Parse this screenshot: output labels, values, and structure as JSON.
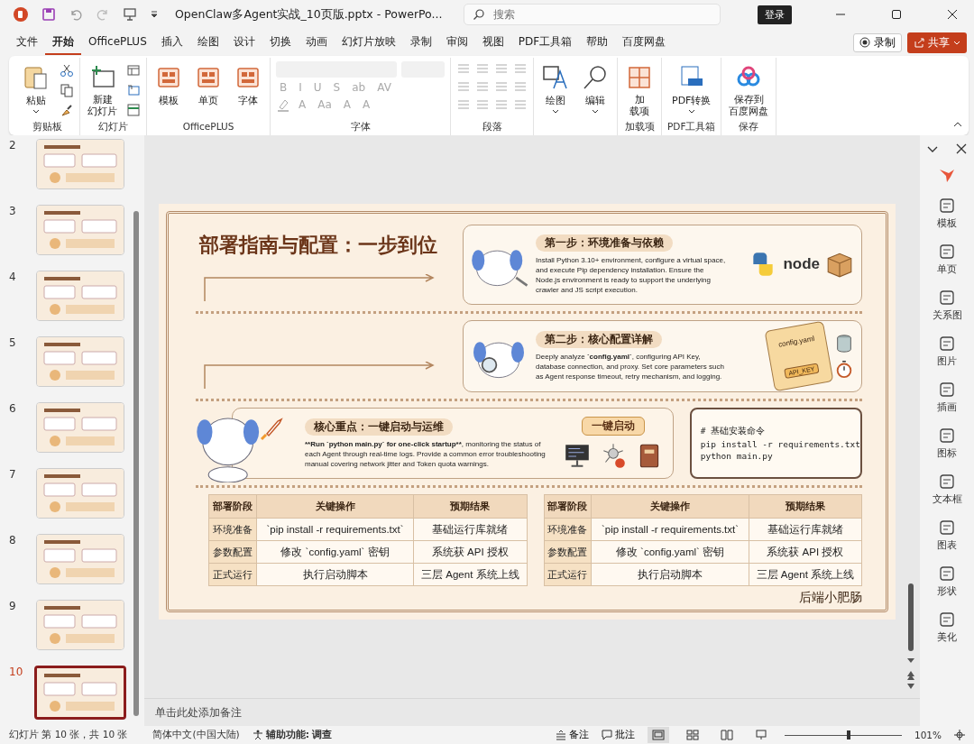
{
  "title_bar": {
    "title": "OpenClaw多Agent实战_10页版.pptx  -  PowerPo...",
    "search_placeholder": "搜索",
    "sign_in": "登录"
  },
  "menu_tabs": [
    {
      "label": "文件",
      "selected": false
    },
    {
      "label": "开始",
      "selected": true
    },
    {
      "label": "OfficePLUS",
      "selected": false
    },
    {
      "label": "插入",
      "selected": false
    },
    {
      "label": "绘图",
      "selected": false
    },
    {
      "label": "设计",
      "selected": false
    },
    {
      "label": "切换",
      "selected": false
    },
    {
      "label": "动画",
      "selected": false
    },
    {
      "label": "幻灯片放映",
      "selected": false
    },
    {
      "label": "录制",
      "selected": false
    },
    {
      "label": "审阅",
      "selected": false
    },
    {
      "label": "视图",
      "selected": false
    },
    {
      "label": "PDF工具箱",
      "selected": false
    },
    {
      "label": "帮助",
      "selected": false
    },
    {
      "label": "百度网盘",
      "selected": false
    }
  ],
  "record_button": "录制",
  "share_button": "共享",
  "ribbon": {
    "clipboard": {
      "paste": "粘贴",
      "label": "剪贴板"
    },
    "slides": {
      "new_slide": [
        "新建",
        "幻灯片"
      ],
      "label": "幻灯片"
    },
    "officeplus": {
      "buttons": [
        "模板",
        "单页",
        "字体"
      ],
      "label": "OfficePLUS"
    },
    "font": {
      "row1": [
        "B",
        "I",
        "U",
        "S",
        "ab",
        "AV"
      ],
      "row2": [
        "A",
        "Aa",
        "A",
        "A"
      ],
      "label": "字体"
    },
    "paragraph": {
      "label": "段落"
    },
    "draw": "绘图",
    "edit": "编辑",
    "addins": {
      "button": [
        "加",
        "载项"
      ],
      "label": "加载项"
    },
    "pdf": {
      "button": "PDF转换",
      "label": "PDF工具箱"
    },
    "save": {
      "button": [
        "保存到",
        "百度网盘"
      ],
      "label": "保存"
    }
  },
  "slide_thumbnails": [
    {
      "number": "2",
      "selected": false
    },
    {
      "number": "3",
      "selected": false
    },
    {
      "number": "4",
      "selected": false
    },
    {
      "number": "5",
      "selected": false
    },
    {
      "number": "6",
      "selected": false
    },
    {
      "number": "7",
      "selected": false
    },
    {
      "number": "8",
      "selected": false
    },
    {
      "number": "9",
      "selected": false
    },
    {
      "number": "10",
      "selected": true
    }
  ],
  "slide": {
    "title": "部署指南与配置：一步到位",
    "step_cards": [
      {
        "heading": "第一步：环境准备与依赖",
        "body": "Install Python 3.10+ environment, configure a virtual space, and execute Pip dependency installation. Ensure the Node.js environment is ready to support the underlying crawler and JS script execution.",
        "logo_text": "node"
      },
      {
        "heading": "第二步：核心配置详解",
        "body": "Deeply analyze **`config.yaml`**, configuring API Key, database connection, and proxy. Set core parameters such as Agent response timeout, retry mechanism, and logging.",
        "notebook_labels": [
          "config.yaml",
          "API_KEY"
        ]
      }
    ],
    "core_card": {
      "heading": "核心重点：一键启动与运维",
      "body_lead": "**Run `python main.py` for one-click startup**",
      "body": ", monitoring the status of each Agent through real-time logs. Provide a common error troubleshooting manual covering network jitter and Token quota warnings.",
      "button": "一键启动"
    },
    "code_box": {
      "lines": [
        "# 基础安装命令",
        "pip install -r requirements.txt",
        "python main.py"
      ]
    },
    "tables": [
      {
        "columns": [
          "部署阶段",
          "关键操作",
          "预期结果"
        ],
        "rows": [
          [
            "环境准备",
            "`pip install -r requirements.txt`",
            "基础运行库就绪"
          ],
          [
            "参数配置",
            "修改 `config.yaml` 密钥",
            "系统获 API 授权"
          ],
          [
            "正式运行",
            "执行启动脚本",
            "三层 Agent 系统上线"
          ]
        ]
      },
      {
        "columns": [
          "部署阶段",
          "关键操作",
          "预期结果"
        ],
        "rows": [
          [
            "环境准备",
            "`pip install -r requirements.txt`",
            "基础运行库就绪"
          ],
          [
            "参数配置",
            "修改 `config.yaml` 密钥",
            "系统获 API 授权"
          ],
          [
            "正式运行",
            "执行启动脚本",
            "三层 Agent 系统上线"
          ]
        ]
      }
    ],
    "author": "后端小肥肠"
  },
  "notes_placeholder": "单击此处添加备注",
  "right_pane": {
    "items": [
      "模板",
      "单页",
      "关系图",
      "图片",
      "插画",
      "图标",
      "文本框",
      "图表",
      "形状",
      "美化"
    ]
  },
  "status_bar": {
    "slide_count": "幻灯片 第 10 张，共 10 张",
    "language": "简体中文(中国大陆)",
    "accessibility": "辅助功能: 调查",
    "notes": "备注",
    "comments": "批注",
    "zoom_slider": {
      "level": 0.55
    },
    "zoom": "101%"
  }
}
